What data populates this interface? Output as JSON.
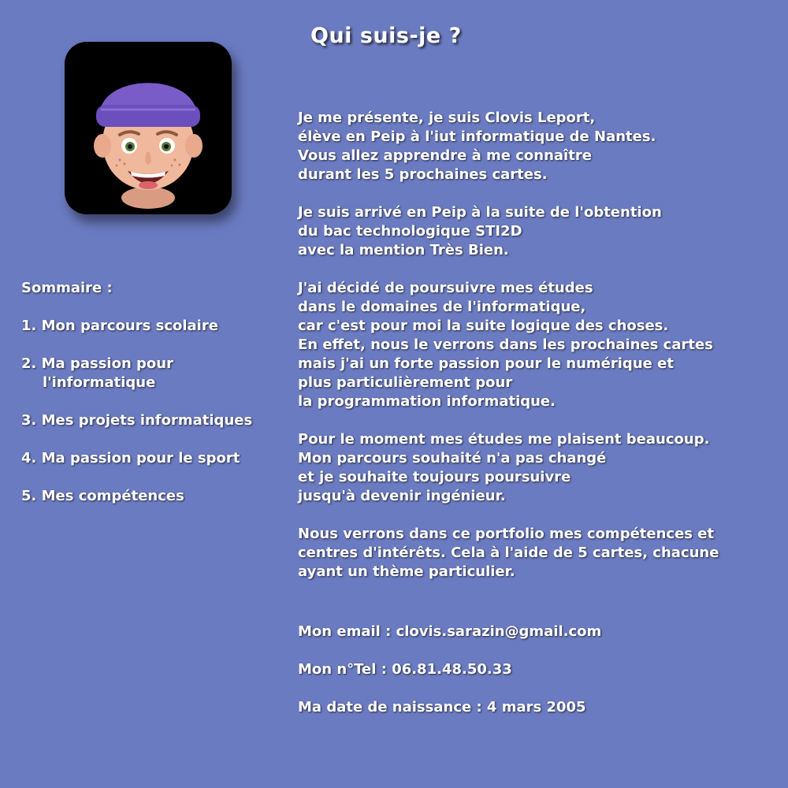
{
  "title": "Qui suis-je ?",
  "avatar": {
    "icon": "memoji-avatar-icon",
    "background": "#000000",
    "beanie_color": "#7a5cc9"
  },
  "colors": {
    "background": "#6b7bc1",
    "text": "#ffffff"
  },
  "summary": {
    "heading": "Sommaire :",
    "items": [
      [
        "1. Mon parcours scolaire"
      ],
      [
        "2. Ma passion pour",
        "l'informatique"
      ],
      [
        "3. Mes projets informatiques"
      ],
      [
        "4. Ma passion pour le sport"
      ],
      [
        "5. Mes compétences"
      ]
    ]
  },
  "paragraphs": [
    [
      "Je me présente, je suis Clovis Leport,",
      "élève en Peip à l'iut informatique de Nantes.",
      "Vous allez apprendre à me connaître",
      "durant les 5 prochaines cartes."
    ],
    [
      "Je suis arrivé en Peip à la suite de l'obtention",
      "du bac technologique STI2D",
      "avec la mention Très Bien."
    ],
    [
      "J'ai décidé de poursuivre mes études",
      "dans le domaines de l'informatique,",
      "car c'est pour moi la suite logique des choses.",
      "En effet, nous le verrons dans les prochaines cartes",
      "mais j'ai un forte passion pour le numérique et",
      "plus particulièrement pour",
      "la programmation informatique."
    ],
    [
      "Pour le moment mes études me plaisent beaucoup.",
      "Mon parcours souhaité n'a pas changé",
      "et je souhaite toujours poursuivre",
      "jusqu'à devenir ingénieur."
    ],
    [
      "Nous verrons dans ce portfolio mes compétences et",
      "centres d'intérêts. Cela à l'aide de 5 cartes, chacune",
      "ayant un thème particulier."
    ]
  ],
  "contact": {
    "email": "Mon email : clovis.sarazin@gmail.com",
    "phone": "Mon n°Tel : 06.81.48.50.33",
    "birthdate": "Ma date de naissance : 4 mars 2005"
  }
}
